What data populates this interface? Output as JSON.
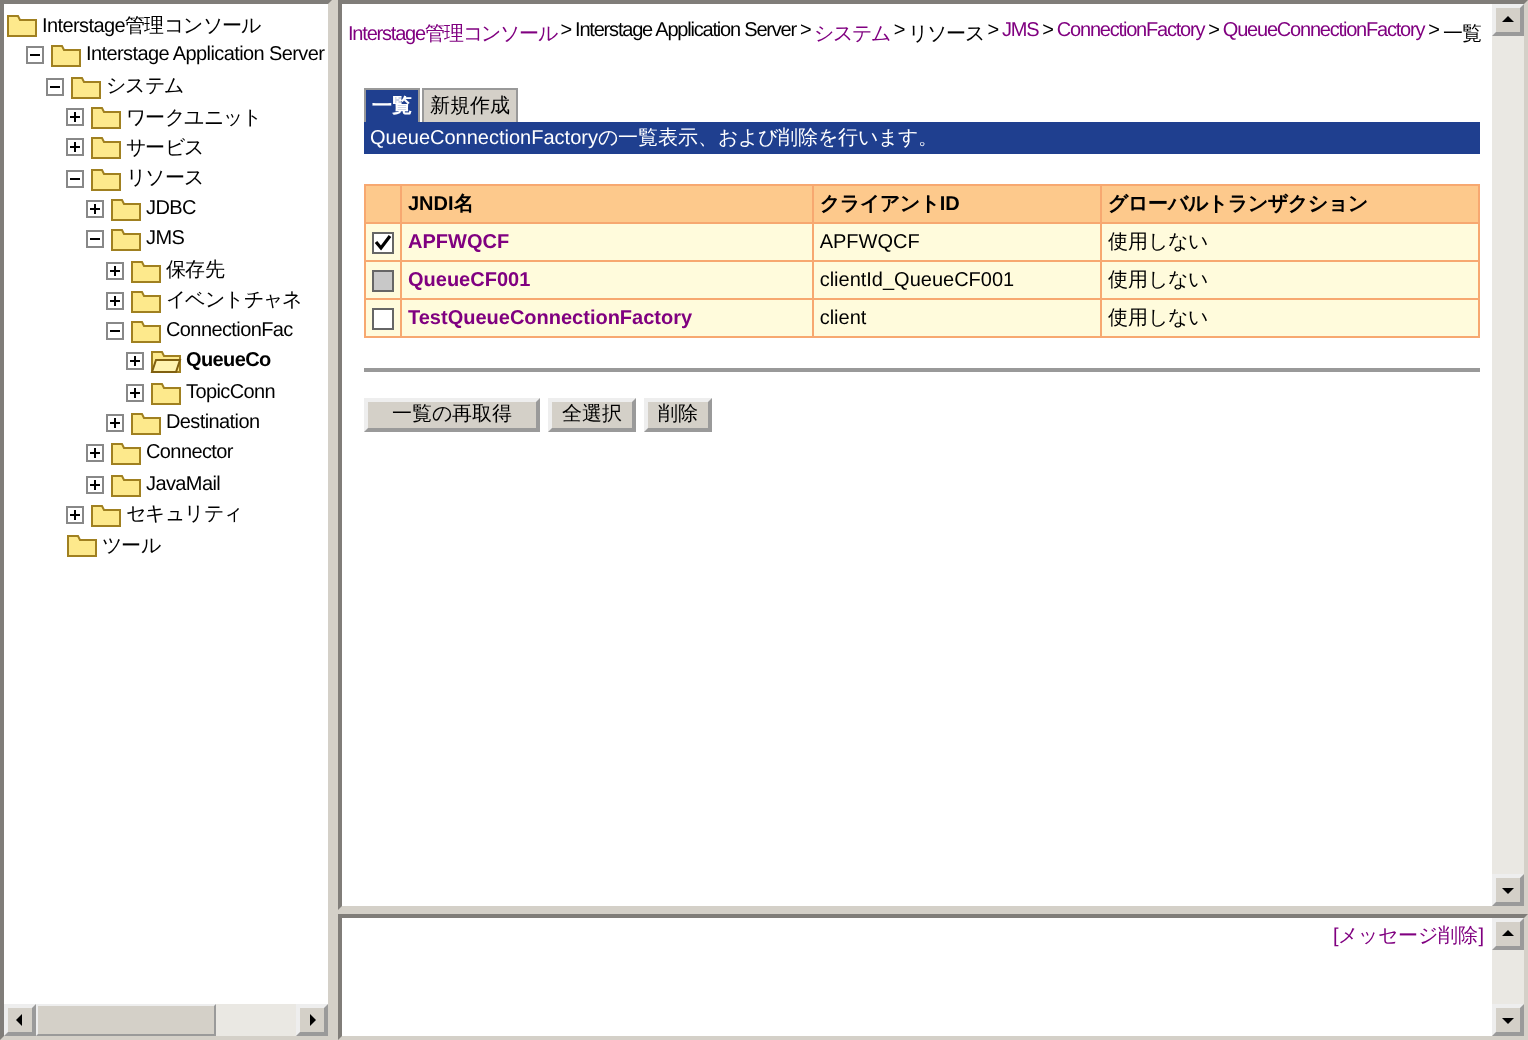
{
  "tree": [
    {
      "label": "Interstage管理コンソール",
      "selected": false,
      "children": [
        {
          "label": "Interstage Application Server",
          "selected": false,
          "expanded": true,
          "children": [
            {
              "label": "システム",
              "selected": false,
              "expanded": true,
              "children": [
                {
                  "label": "ワークユニット",
                  "selected": false,
                  "expanded": false
                },
                {
                  "label": "サービス",
                  "selected": false,
                  "expanded": false
                },
                {
                  "label": "リソース",
                  "selected": false,
                  "expanded": true,
                  "children": [
                    {
                      "label": "JDBC",
                      "selected": false,
                      "expanded": false
                    },
                    {
                      "label": "JMS",
                      "selected": false,
                      "expanded": true,
                      "children": [
                        {
                          "label": "保存先",
                          "selected": false,
                          "expanded": false
                        },
                        {
                          "label": "イベントチャネ",
                          "selected": false,
                          "expanded": false
                        },
                        {
                          "label": "ConnectionFac",
                          "selected": false,
                          "expanded": true,
                          "children": [
                            {
                              "label": "QueueCo",
                              "selected": true,
                              "expanded": false
                            },
                            {
                              "label": "TopicConn",
                              "selected": false,
                              "expanded": false
                            }
                          ]
                        },
                        {
                          "label": "Destination",
                          "selected": false,
                          "expanded": false
                        }
                      ]
                    },
                    {
                      "label": "Connector",
                      "selected": false,
                      "expanded": false
                    },
                    {
                      "label": "JavaMail",
                      "selected": false,
                      "expanded": false
                    }
                  ]
                },
                {
                  "label": "セキュリティ",
                  "selected": false,
                  "expanded": false
                },
                {
                  "label": "ツール",
                  "selected": false
                }
              ]
            }
          ]
        }
      ]
    }
  ],
  "breadcrumb_separator": ">",
  "breadcrumb": [
    {
      "label": "Interstage管理コンソール",
      "link": true
    },
    {
      "label": "Interstage Application Server",
      "link": false
    },
    {
      "label": "システム",
      "link": true
    },
    {
      "label": "リソース",
      "link": false
    },
    {
      "label": "JMS",
      "link": true
    },
    {
      "label": "ConnectionFactory",
      "link": true
    },
    {
      "label": "QueueConnectionFactory",
      "link": true
    },
    {
      "label": "一覧",
      "link": false
    }
  ],
  "tabs": [
    {
      "label": "一覧",
      "selected": true
    },
    {
      "label": "新規作成",
      "selected": false
    }
  ],
  "description": "QueueConnectionFactoryの一覧表示、および削除を行います。",
  "table": {
    "columns": [
      "JNDI名",
      "クライアントID",
      "グローバルトランザクション"
    ],
    "rows": [
      {
        "checked": true,
        "disabled": false,
        "cells": [
          "APFWQCF",
          "APFWQCF",
          "使用しない"
        ]
      },
      {
        "checked": false,
        "disabled": true,
        "cells": [
          "QueueCF001",
          "clientId_QueueCF001",
          "使用しない"
        ]
      },
      {
        "checked": false,
        "disabled": false,
        "cells": [
          "TestQueueConnectionFactory",
          "client",
          "使用しない"
        ]
      }
    ]
  },
  "buttons": [
    "一覧の再取得",
    "全選択",
    "削除"
  ],
  "message_link": "[メッセージ削除]"
}
